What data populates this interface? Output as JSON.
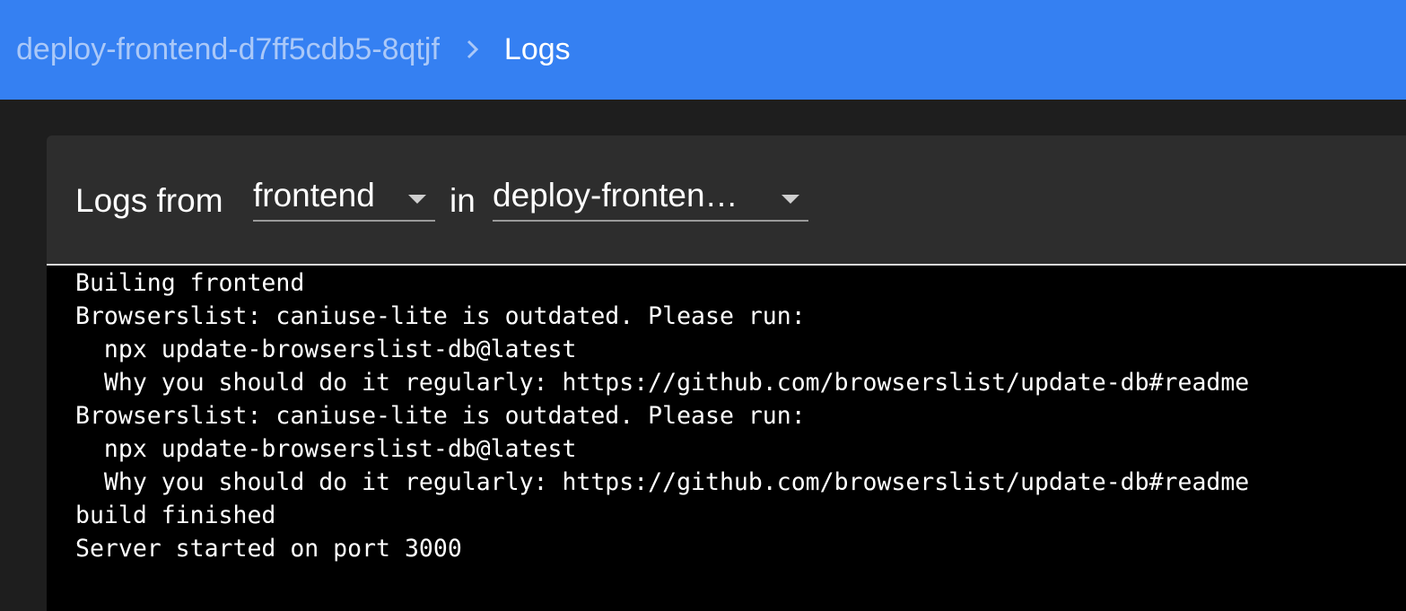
{
  "breadcrumb": {
    "parent": "deploy-frontend-d7ff5cdb5-8qtjf",
    "current": "Logs"
  },
  "log_header": {
    "prefix": "Logs from",
    "container_select": "frontend",
    "connector": "in",
    "pod_select": "deploy-fronten…"
  },
  "log_lines": [
    "Builing frontend",
    "Browserslist: caniuse-lite is outdated. Please run:",
    "  npx update-browserslist-db@latest",
    "  Why you should do it regularly: https://github.com/browserslist/update-db#readme",
    "Browserslist: caniuse-lite is outdated. Please run:",
    "  npx update-browserslist-db@latest",
    "  Why you should do it regularly: https://github.com/browserslist/update-db#readme",
    "build finished",
    "Server started on port 3000"
  ],
  "colors": {
    "topbar": "#3580f2",
    "page_background": "#1e1e1e",
    "card_background": "#2d2d2d",
    "log_background": "#000000"
  },
  "icons": {
    "breadcrumb_separator": "chevron-right-icon",
    "select_caret": "arrow-drop-down-icon"
  }
}
